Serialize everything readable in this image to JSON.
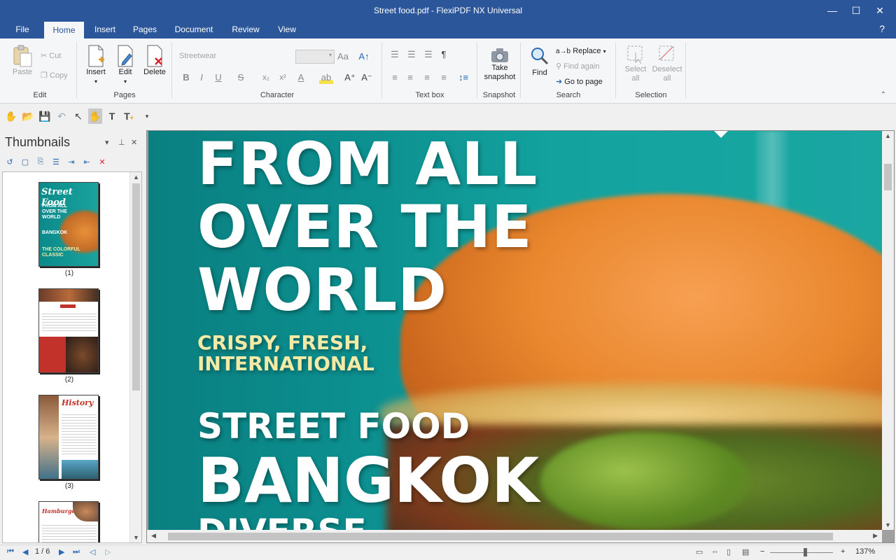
{
  "window": {
    "title": "Street food.pdf - FlexiPDF NX Universal",
    "minimize": "—",
    "maximize": "☐",
    "close": "✕"
  },
  "tabs": [
    {
      "label": "File"
    },
    {
      "label": "Home"
    },
    {
      "label": "Insert"
    },
    {
      "label": "Pages"
    },
    {
      "label": "Document"
    },
    {
      "label": "Review"
    },
    {
      "label": "View"
    }
  ],
  "active_tab": "Home",
  "help_label": "?",
  "ribbon": {
    "edit": {
      "label": "Edit",
      "paste": "Paste",
      "cut": "Cut",
      "copy": "Copy"
    },
    "pages": {
      "label": "Pages",
      "insert": "Insert",
      "edit": "Edit",
      "delete": "Delete"
    },
    "character": {
      "label": "Character",
      "font_placeholder": "Streetwear",
      "font_size": ""
    },
    "textbox": {
      "label": "Text box"
    },
    "snapshot": {
      "label": "Snapshot",
      "take_line1": "Take",
      "take_line2": "snapshot"
    },
    "search": {
      "label": "Search",
      "find": "Find",
      "replace": "Replace",
      "find_again": "Find again",
      "goto_page": "Go to page"
    },
    "selection": {
      "label": "Selection",
      "select_line1": "Select",
      "select_line2": "all",
      "deselect_line1": "Deselect",
      "deselect_line2": "all"
    }
  },
  "thumbnails": {
    "title": "Thumbnails",
    "items": [
      {
        "caption": "(1)",
        "heading": "Street Food"
      },
      {
        "caption": "(2)",
        "heading": ""
      },
      {
        "caption": "(3)",
        "heading": "History"
      },
      {
        "caption": "",
        "heading": "Hamburger"
      }
    ],
    "page1_lines": [
      "FROM ALL",
      "OVER THE",
      "WORLD",
      "BANGKOK",
      "THE COLORFUL",
      "CLASSIC"
    ]
  },
  "document": {
    "headline_lines": [
      "FROM ALL",
      "OVER THE",
      "WORLD"
    ],
    "tagline_lines": [
      "CRISPY, FRESH,",
      "INTERNATIONAL"
    ],
    "street_food": "STREET FOOD",
    "city": "BANGKOK",
    "next_word": "DIVERSE"
  },
  "status": {
    "page_indicator": "1 / 6",
    "zoom": "137%",
    "zoom_minus": "−",
    "zoom_plus": "+"
  },
  "colors": {
    "accent": "#2b579a",
    "page_teal": "#0c9090",
    "tagline_yellow": "#f3eaa6",
    "delete_red": "#d9232e"
  }
}
